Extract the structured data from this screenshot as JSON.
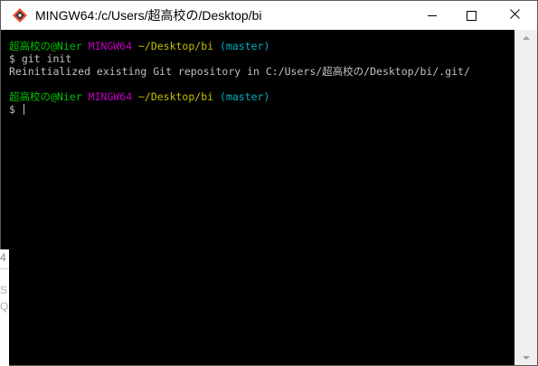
{
  "window": {
    "title": "MINGW64:/c/Users/超高校の/Desktop/bi",
    "icon": "git-bash-icon"
  },
  "terminal": {
    "prompt1": {
      "user_host": "超高校の@Nier",
      "system": "MINGW64",
      "path": "~/Desktop/bi",
      "branch": "(master)"
    },
    "cmd1": "$ git init",
    "output1": "Reinitialized existing Git repository in C:/Users/超高校の/Desktop/bi/.git/",
    "prompt2": {
      "user_host": "超高校の@Nier",
      "system": "MINGW64",
      "path": "~/Desktop/bi",
      "branch": "(master)"
    },
    "cmd2": "$ "
  },
  "background_fragment": {
    "line1": "4",
    "line2": "S",
    "line3": "Q"
  },
  "colors": {
    "user_host": "#00c000",
    "system": "#c000c0",
    "path": "#c0c000",
    "branch": "#00b0c0",
    "text": "#c0c0c0",
    "background": "#000000"
  }
}
